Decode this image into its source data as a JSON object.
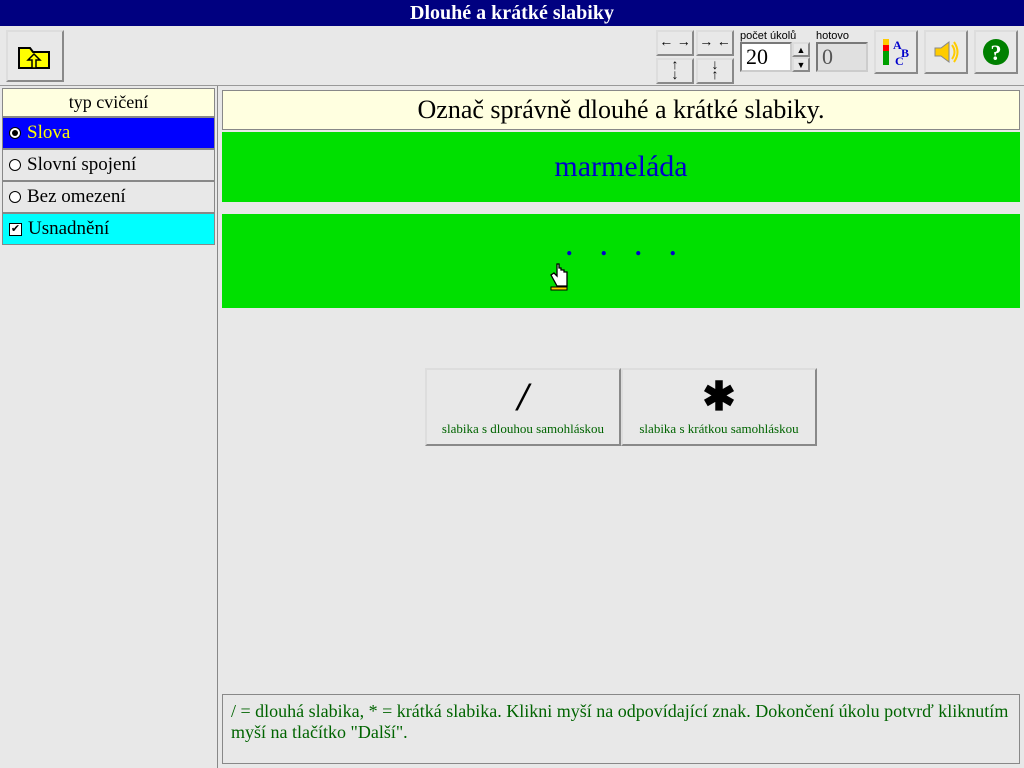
{
  "title": "Dlouhé a krátké slabiky",
  "sidebar": {
    "heading": "typ cvičení",
    "options": [
      {
        "label": "Slova",
        "selected": true
      },
      {
        "label": "Slovní spojení",
        "selected": false
      },
      {
        "label": "Bez omezení",
        "selected": false
      }
    ],
    "easy_label": "Usnadnění",
    "easy_checked": true
  },
  "toolbar": {
    "tasks_label": "počet úkolů",
    "tasks_value": "20",
    "done_label": "hotovo",
    "done_value": "0"
  },
  "main": {
    "instruction": "Označ správně dlouhé a krátké slabiky.",
    "word": "marmeláda",
    "dots": [
      ".",
      ".",
      ".",
      "."
    ],
    "choices": {
      "long_symbol": "/",
      "long_label": "slabika s dlouhou samohláskou",
      "short_symbol": "✱",
      "short_label": "slabika s krátkou samohláskou"
    },
    "help": " / = dlouhá slabika, * = krátká slabika. Klikni myší na odpovídající znak. Dokončení úkolu potvrď kliknutím myší na tlačítko \"Další\"."
  }
}
